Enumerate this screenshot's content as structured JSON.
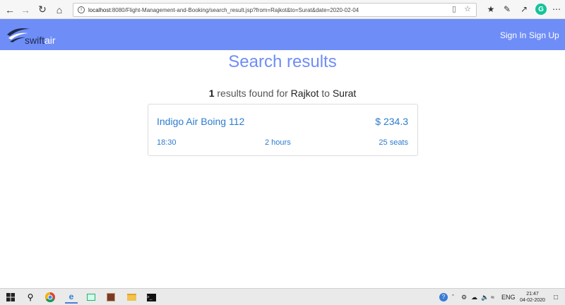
{
  "browser": {
    "url_host": "localhost",
    "url_path": ":8080/Flight-Management-and-Booking/search_result.jsp?from=Rajkot&to=Surat&date=2020-02-04"
  },
  "header": {
    "logo_swift": "swift",
    "logo_air": "air",
    "sign_in": "Sign In",
    "sign_up": "Sign Up",
    "bg_color": "#6f8df7"
  },
  "main": {
    "title": "Search results",
    "summary": {
      "count": "1",
      "text_found": "results found for",
      "from": "Rajkot",
      "text_to": "to",
      "to": "Surat"
    },
    "results": [
      {
        "name": "Indigo Air Boing 112",
        "price": "$ 234.3",
        "time": "18:30",
        "duration": "2 hours",
        "seats": "25 seats"
      }
    ]
  },
  "taskbar": {
    "language": "ENG",
    "time": "21:47",
    "date": "04-02-2020"
  },
  "colors": {
    "accent": "#6f8df7",
    "link": "#2d7bd0"
  }
}
